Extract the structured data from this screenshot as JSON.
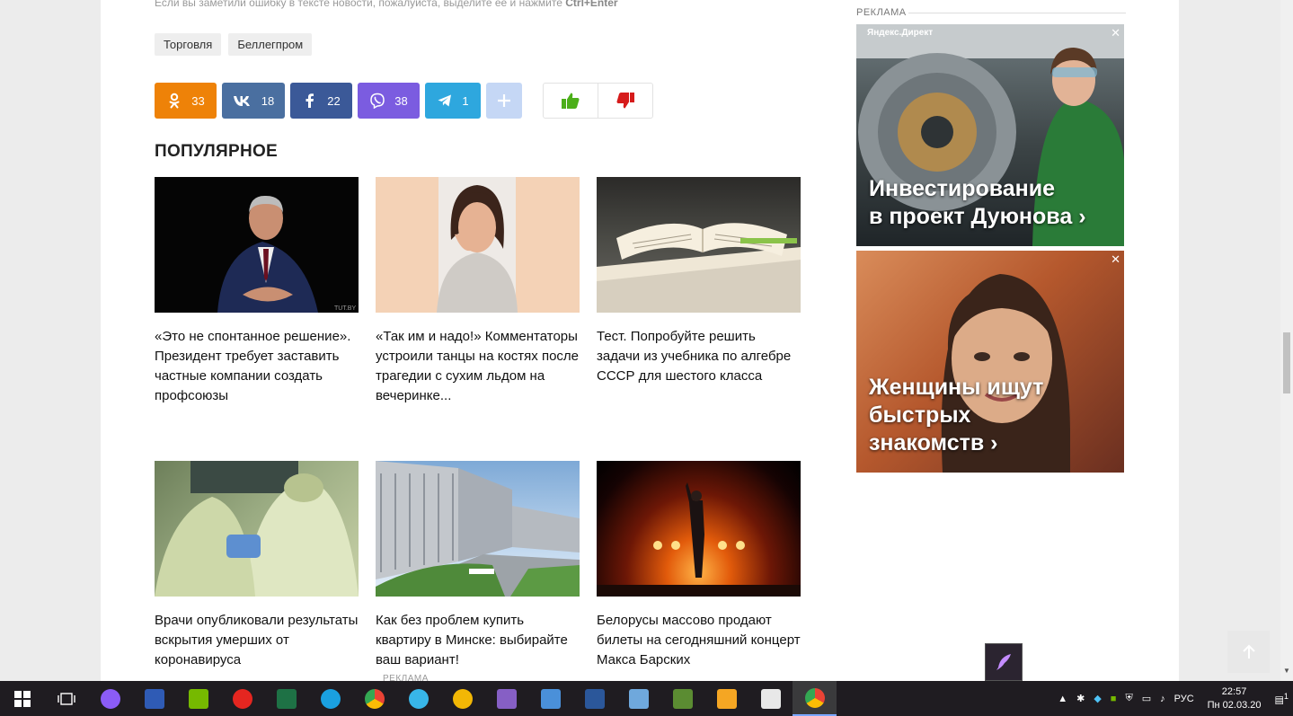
{
  "notice": {
    "text": "Если вы заметили ошибку в тексте новости, пожалуйста, выделите её и нажмите",
    "hotkey": "Ctrl+Enter"
  },
  "tags": [
    "Торговля",
    "Беллегпром"
  ],
  "share": {
    "ok": "33",
    "vk": "18",
    "fb": "22",
    "viber": "38",
    "telegram": "1"
  },
  "popular": {
    "title": "ПОПУЛЯРНОЕ",
    "cards": [
      {
        "text": "«Это не спонтанное решение». Президент требует заставить частные компании создать профсоюзы",
        "watermark": "TUT.BY"
      },
      {
        "text": "«Так им и надо!» Комментаторы устроили танцы на костях после трагедии с сухим льдом на вечеринке..."
      },
      {
        "text": "Тест. Попробуйте решить задачи из учебника по алгебре СССР для шестого класса"
      },
      {
        "text": "Врачи опубликовали результаты вскрытия умерших от коронавируса"
      },
      {
        "text": "Как без проблем купить квартиру в Минске: выбирайте ваш вариант!"
      },
      {
        "text": "Белорусы массово продают билеты на сегодняшний концерт Макса Барских"
      }
    ],
    "ad_label": "РЕКЛАМА"
  },
  "sidebar": {
    "ad_label": "РЕКЛАМА",
    "ad1": {
      "provider": "Яндекс.Директ",
      "line1": "Инвестирование",
      "line2": "в проект Дуюнова ›"
    },
    "ad2": {
      "line1": "Женщины ищут",
      "line2": "быстрых",
      "line3": "знакомств ›"
    },
    "close": "✕"
  },
  "taskbar": {
    "lang": "РУС",
    "time": "22:57",
    "date": "Пн 02.03.20",
    "notifications": "1"
  }
}
